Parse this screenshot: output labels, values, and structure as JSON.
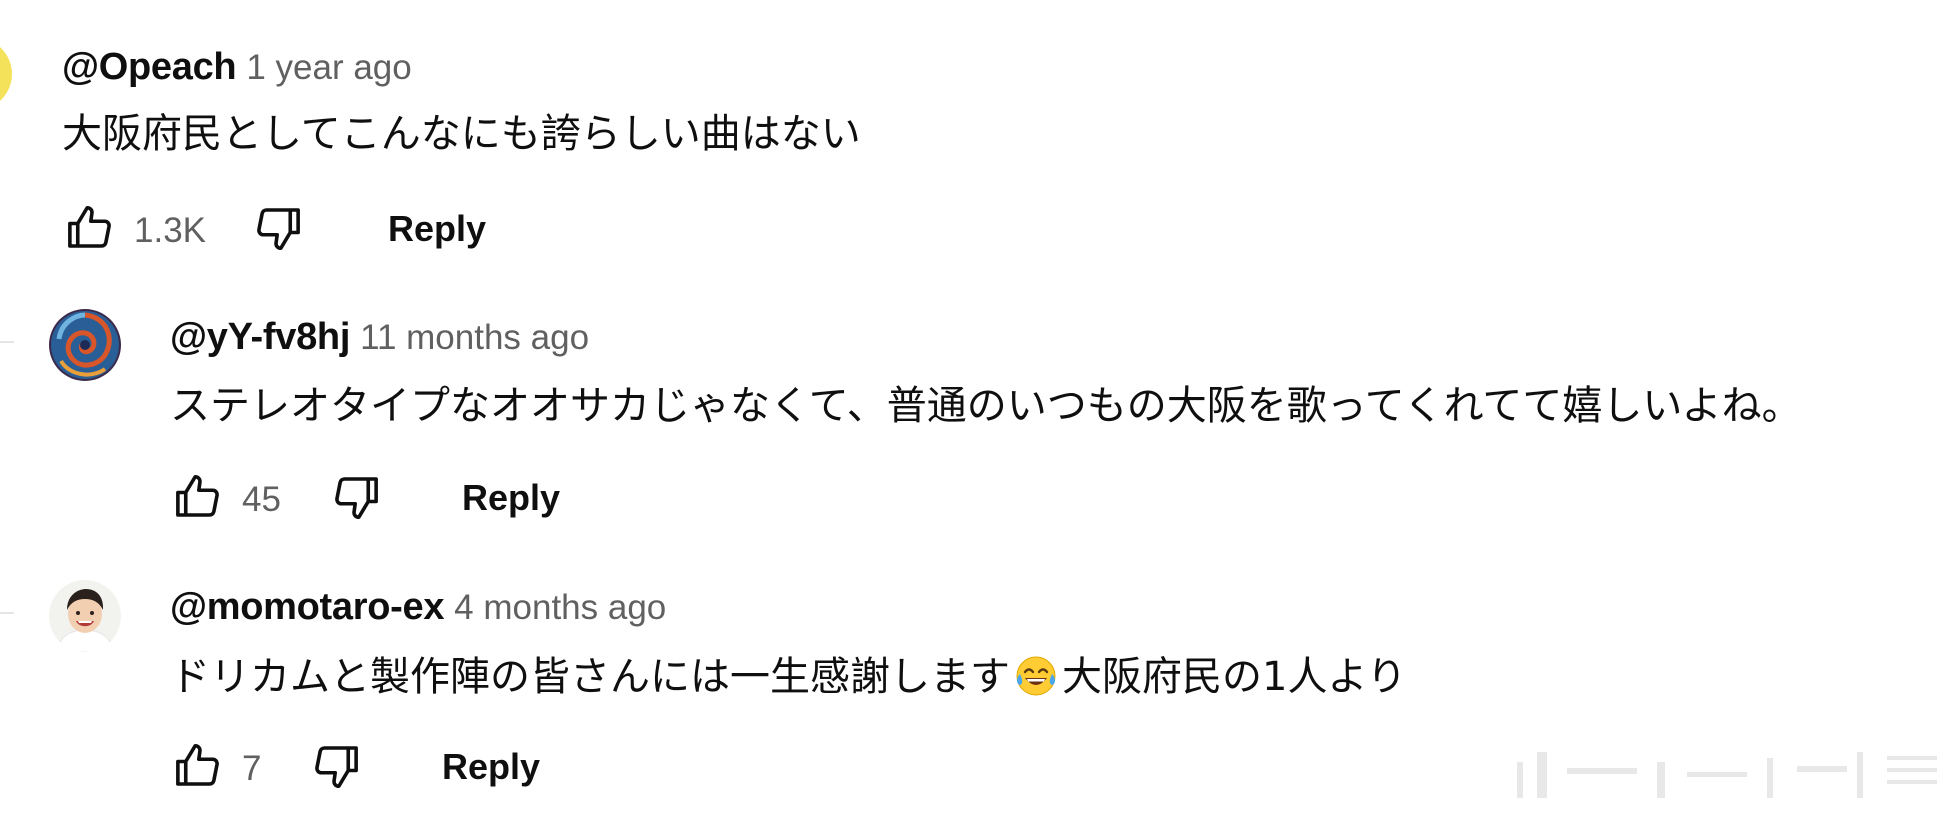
{
  "comments": [
    {
      "author": "@Opeach",
      "time": "1 year ago",
      "text": "大阪府民としてこんなにも誇らしい曲はない",
      "likes": "1.3K",
      "reply_label": "Reply",
      "avatar_color": "#f2e04b"
    },
    {
      "author": "@yY-fv8hj",
      "time": "11 months ago",
      "text": "ステレオタイプなオオサカじゃなくて、普通のいつもの大阪を歌ってくれてて嬉しいよね。",
      "likes": "45",
      "reply_label": "Reply",
      "avatar_color": "#2f6ea8"
    },
    {
      "author": "@momotaro-ex",
      "time": "4 months ago",
      "text_before_emoji": "ドリカムと製作陣の皆さんには一生感謝します",
      "text_after_emoji": "大阪府民の1人より",
      "emoji": "face-with-tears-of-joy",
      "likes": "7",
      "reply_label": "Reply",
      "avatar_color": "#f2d9c4"
    }
  ],
  "icons": {
    "like": "thumbs-up-icon",
    "dislike": "thumbs-down-icon"
  }
}
